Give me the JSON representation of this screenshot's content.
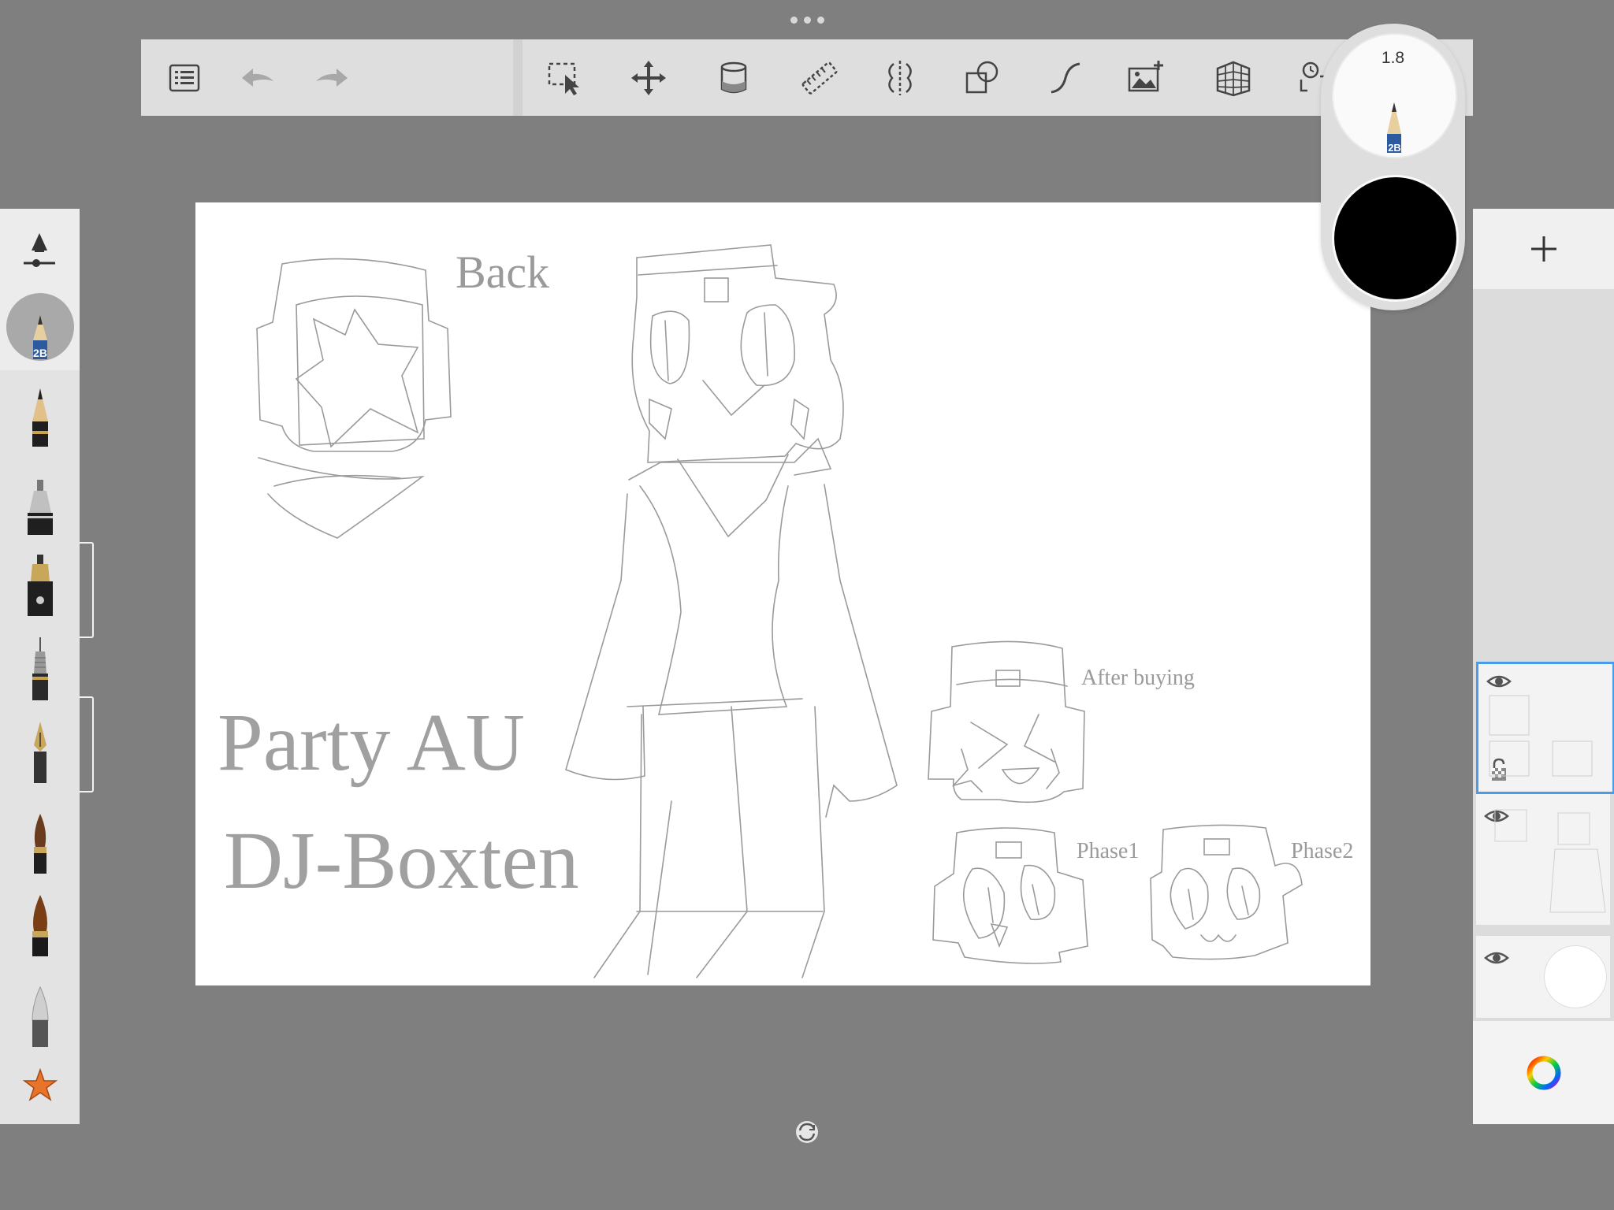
{
  "app": "Sketchbook",
  "toolbar": {
    "items": [
      "menu-icon",
      "undo-icon",
      "redo-icon",
      "selection-icon",
      "move-icon",
      "fill-icon",
      "ruler-icon",
      "symmetry-icon",
      "shapes-icon",
      "curve-icon",
      "add-image-icon",
      "perspective-icon",
      "timelapse-icon",
      "text-icon"
    ]
  },
  "brush_puck": {
    "size": "1.8",
    "brush_grade": "2B",
    "color": "#000000"
  },
  "left_panel": {
    "active_brush_grade": "2B",
    "brushes": [
      "pencil",
      "marker",
      "ink-pen",
      "technical-pen",
      "calligraphy-pen",
      "paint-brush",
      "ink-brush",
      "airbrush",
      "favorites-star"
    ]
  },
  "canvas": {
    "labels": {
      "back": "Back",
      "after_buying": "After buying",
      "phase1": "Phase1",
      "phase2": "Phase2",
      "title1": "Party AU",
      "title2": "DJ-Boxten"
    }
  },
  "layers": [
    {
      "name": "layer-1",
      "visible": true,
      "selected": true,
      "locked": true
    },
    {
      "name": "layer-2",
      "visible": true,
      "selected": false,
      "locked": false
    },
    {
      "name": "background",
      "visible": true,
      "selected": false,
      "locked": false
    }
  ],
  "colors": {
    "background": "#7f7f7f",
    "accent": "#4a9be8",
    "favorite": "#e8732a"
  }
}
